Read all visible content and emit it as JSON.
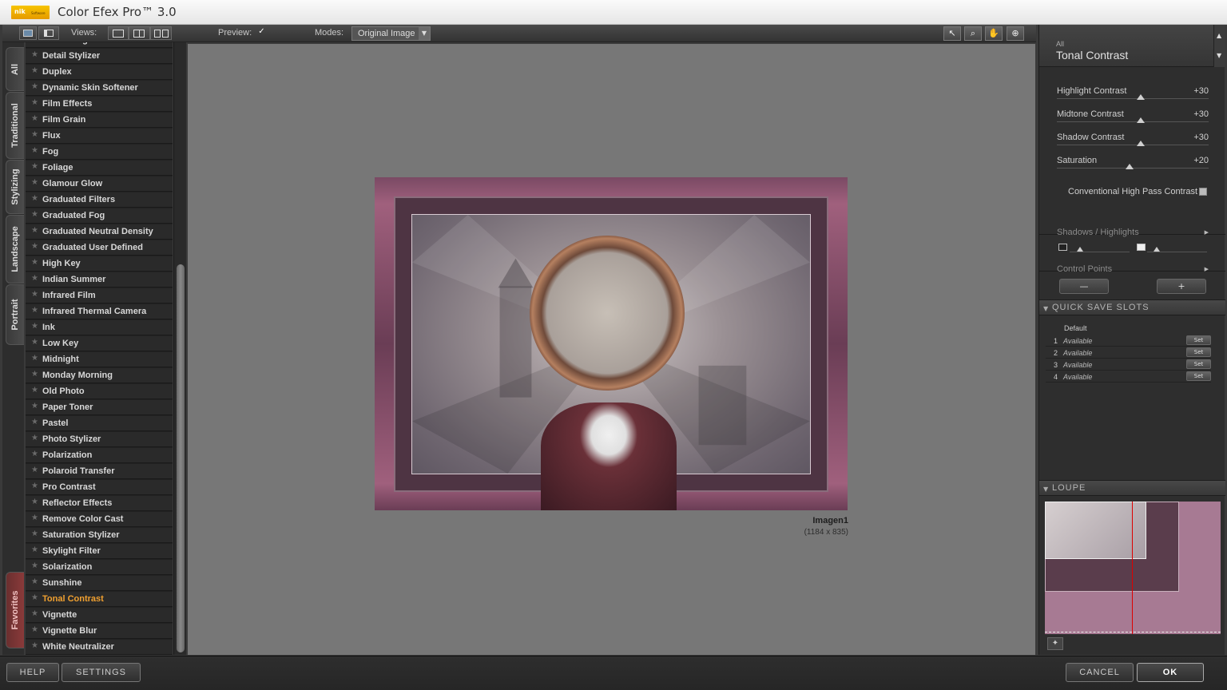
{
  "app": {
    "title": "Color Efex Pro™ 3.0",
    "logo_text": "nik",
    "logo_sub": "Software"
  },
  "toolbar": {
    "views_label": "Views:",
    "preview_label": "Preview:",
    "preview_checked": "✓",
    "modes_label": "Modes:",
    "mode_value": "Original Image",
    "tools": [
      "pointer",
      "zoom",
      "hand",
      "control-point"
    ]
  },
  "tabs": [
    "All",
    "Traditional",
    "Stylizing",
    "Landscape",
    "Portrait",
    "Favorites"
  ],
  "filters": [
    "Darken/Lighten Center",
    "Detail Stylizer",
    "Duplex",
    "Dynamic Skin Softener",
    "Film Effects",
    "Film Grain",
    "Flux",
    "Fog",
    "Foliage",
    "Glamour Glow",
    "Graduated Filters",
    "Graduated Fog",
    "Graduated Neutral Density",
    "Graduated User Defined",
    "High Key",
    "Indian Summer",
    "Infrared Film",
    "Infrared Thermal Camera",
    "Ink",
    "Low Key",
    "Midnight",
    "Monday Morning",
    "Old Photo",
    "Paper Toner",
    "Pastel",
    "Photo Stylizer",
    "Polarization",
    "Polaroid Transfer",
    "Pro Contrast",
    "Reflector Effects",
    "Remove Color Cast",
    "Saturation Stylizer",
    "Skylight Filter",
    "Solarization",
    "Sunshine",
    "Tonal Contrast",
    "Vignette",
    "Vignette Blur",
    "White Neutralizer"
  ],
  "active_filter": "Tonal Contrast",
  "image": {
    "name": "Imagen1",
    "dims": "(1184 x 835)"
  },
  "panel": {
    "category": "All",
    "filter_name": "Tonal Contrast",
    "sliders": [
      {
        "label": "Highlight Contrast",
        "value": "+30",
        "level": 0.55
      },
      {
        "label": "Midtone Contrast",
        "value": "+30",
        "level": 0.55
      },
      {
        "label": "Shadow Contrast",
        "value": "+30",
        "level": 0.55
      },
      {
        "label": "Saturation",
        "value": "+20",
        "level": 0.48
      }
    ],
    "checkbox_label": "Conventional High Pass Contrast",
    "shadows_highlights": "Shadows / Highlights",
    "control_points": "Control Points",
    "control_points_minus": "—",
    "control_points_plus": "+"
  },
  "quick_save": {
    "title": "QUICK SAVE SLOTS",
    "default": "Default",
    "slots": [
      {
        "num": "1",
        "status": "Available",
        "button": "Set"
      },
      {
        "num": "2",
        "status": "Available",
        "button": "Set"
      },
      {
        "num": "3",
        "status": "Available",
        "button": "Set"
      },
      {
        "num": "4",
        "status": "Available",
        "button": "Set"
      }
    ]
  },
  "loupe": {
    "title": "LOUPE"
  },
  "bottom": {
    "help": "HELP",
    "settings": "SETTINGS",
    "cancel": "CANCEL",
    "ok": "OK"
  },
  "colors": {
    "accent_active": "#f0a030",
    "panel_bg": "#2e2e2e",
    "canvas_bg": "#777777",
    "image_frame": "#a0607d"
  }
}
